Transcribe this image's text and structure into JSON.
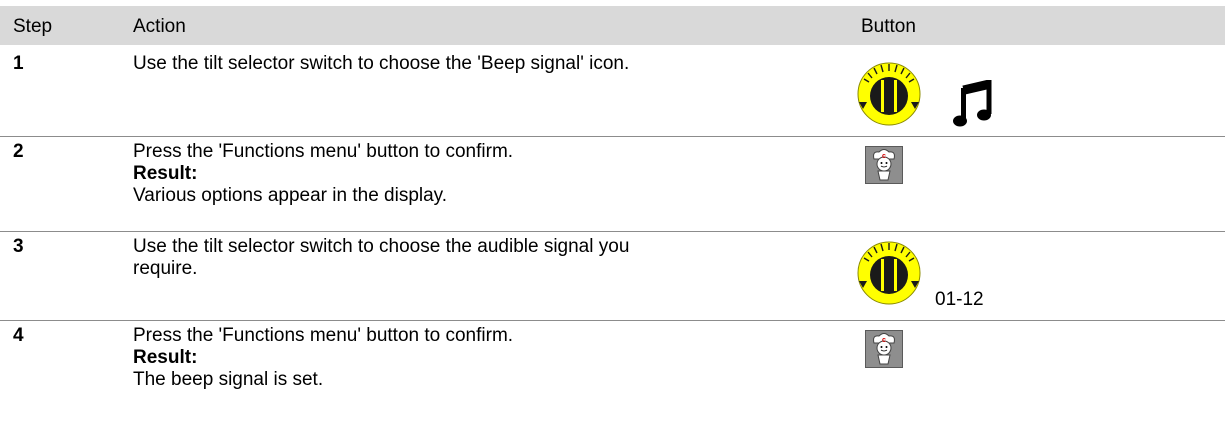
{
  "header": {
    "step": "Step",
    "action": "Action",
    "button": "Button"
  },
  "rows": [
    {
      "step": "1",
      "action_lines": [
        "Use the tilt selector switch to choose the 'Beep signal' icon."
      ],
      "buttons": [
        "tilt-selector-dial",
        "music-note"
      ]
    },
    {
      "step": "2",
      "action_lines": [
        "Press the 'Functions menu' button to confirm."
      ],
      "result_label": "Result:",
      "result_text": "Various options appear in the display.",
      "buttons": [
        "functions-menu-chef"
      ]
    },
    {
      "step": "3",
      "action_lines": [
        "Use the tilt selector switch to choose the audible signal you",
        "require."
      ],
      "buttons": [
        "tilt-selector-dial"
      ],
      "button_label": "01-12"
    },
    {
      "step": "4",
      "action_lines": [
        "Press the 'Functions menu' button to confirm."
      ],
      "result_label": "Result:",
      "result_text": "The beep signal is set.",
      "buttons": [
        "functions-menu-chef"
      ]
    }
  ],
  "colors": {
    "header_bg": "#d9d9d9",
    "dial_yellow": "#ffff00",
    "dial_dark": "#1a1a1a",
    "chef_button_bg": "#8e8e8e",
    "chef_logo_red": "#d40000"
  }
}
